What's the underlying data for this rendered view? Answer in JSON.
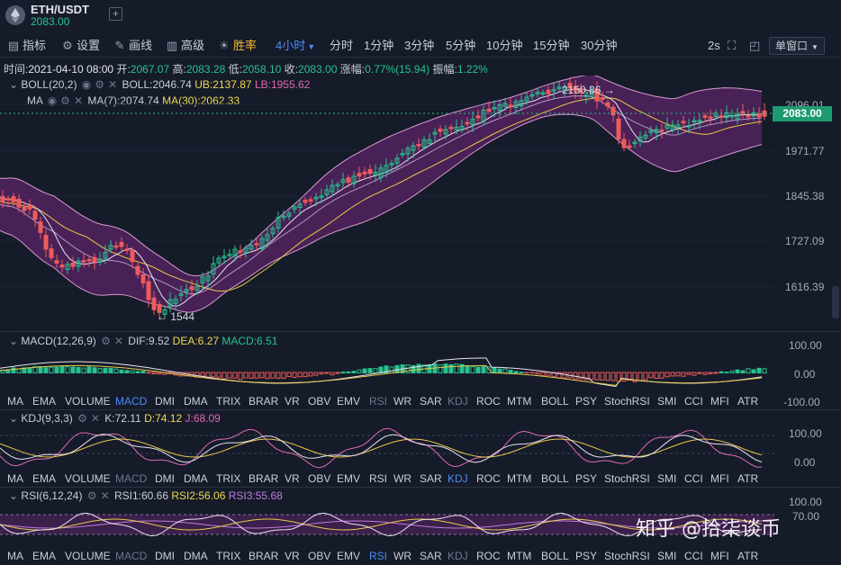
{
  "header": {
    "symbol": "ETH/USDT",
    "price": "2083.00",
    "add": "+"
  },
  "toolbar": {
    "items": [
      {
        "icon": "indicator-icon",
        "label": "指标"
      },
      {
        "icon": "gear-icon",
        "label": "设置"
      },
      {
        "icon": "pencil-icon",
        "label": "画线"
      },
      {
        "icon": "advanced-icon",
        "label": "高级"
      },
      {
        "icon": "sun-icon",
        "label": "胜率"
      }
    ],
    "interval_selected": "4小时",
    "intervals": [
      "分时",
      "1分钟",
      "3分钟",
      "5分钟",
      "10分钟",
      "15分钟",
      "30分钟"
    ],
    "refresh": "2s",
    "window_mode": "单窗口"
  },
  "ohlc": {
    "time_label": "时间:",
    "time": "2021-04-10 08:00",
    "open_label": "开:",
    "open": "2067.07",
    "high_label": "高:",
    "high": "2083.28",
    "low_label": "低:",
    "low": "2058.10",
    "close_label": "收:",
    "close": "2083.00",
    "change_label": "涨幅:",
    "change": "0.77%(15.94)",
    "amp_label": "振幅:",
    "amp": "1.22%"
  },
  "boll": {
    "name": "BOLL(20,2)",
    "mid": "BOLL:2046.74",
    "ub": "UB:2137.87",
    "lb": "LB:1955.62"
  },
  "ma": {
    "name": "MA",
    "ma7": "MA(7):2074.74",
    "ma30": "MA(30):2062.33"
  },
  "price_axis": {
    "labels": [
      "2096.01",
      "1971.77",
      "1845.38",
      "1727.09",
      "1616.39"
    ],
    "current": "2083.00"
  },
  "annotations": {
    "high": "2150.86",
    "low": "1544"
  },
  "macd": {
    "name": "MACD(12,26,9)",
    "dif": "DIF:9.52",
    "dea": "DEA:6.27",
    "macd": "MACD:6.51",
    "axis": [
      "100.00",
      "0.00",
      "-100.00"
    ]
  },
  "kdj": {
    "name": "KDJ(9,3,3)",
    "k": "K:72.11",
    "d": "D:74.12",
    "j": "J:68.09",
    "axis": [
      "100.00",
      "0.00"
    ]
  },
  "rsi": {
    "name": "RSI(6,12,24)",
    "rsi1": "RSI1:60.66",
    "rsi2": "RSI2:56.06",
    "rsi3": "RSI3:55.68",
    "axis": [
      "100.00",
      "70.00"
    ]
  },
  "indicator_tabs": [
    "MA",
    "EMA",
    "VOLUME",
    "MACD",
    "DMI",
    "DMA",
    "TRIX",
    "BRAR",
    "VR",
    "OBV",
    "EMV",
    "RSI",
    "WR",
    "SAR",
    "KDJ",
    "ROC",
    "MTM",
    "BOLL",
    "PSY",
    "StochRSI",
    "SMI",
    "CCI",
    "MFI",
    "ATR"
  ],
  "watermark": "知乎 @拾柒谈币",
  "colors": {
    "up": "#26c28e",
    "down": "#ee5b5b",
    "boll_band": "#6b2c75",
    "accent": "#4c8df6"
  }
}
